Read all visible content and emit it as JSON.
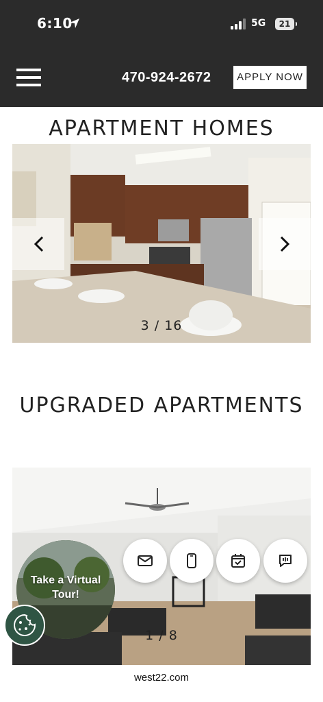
{
  "status_bar": {
    "time": "6:10",
    "network": "5G",
    "battery": "21",
    "icons": [
      "location-arrow-icon",
      "signal-icon",
      "battery-icon"
    ]
  },
  "header": {
    "menu_icon": "hamburger-menu-icon",
    "phone": "470-924-2672",
    "apply_label": "APPLY NOW",
    "background_color": "#2b2b2b"
  },
  "sections": [
    {
      "title": "APARTMENT HOMES",
      "counter": "3 / 16",
      "prev_icon": "chevron-left-icon",
      "next_icon": "chevron-right-icon"
    },
    {
      "title": "UPGRADED APARTMENTS",
      "counter": "1 / 8"
    }
  ],
  "virtual_tour": {
    "label": "Take a Virtual Tour!"
  },
  "floating_actions": [
    {
      "icon": "mail-icon"
    },
    {
      "icon": "phone-icon"
    },
    {
      "icon": "calendar-check-icon"
    },
    {
      "icon": "chat-icon"
    }
  ],
  "cookie_button": {
    "icon": "cookie-icon",
    "color": "#2f5544"
  },
  "browser": {
    "url": "west22.com"
  }
}
